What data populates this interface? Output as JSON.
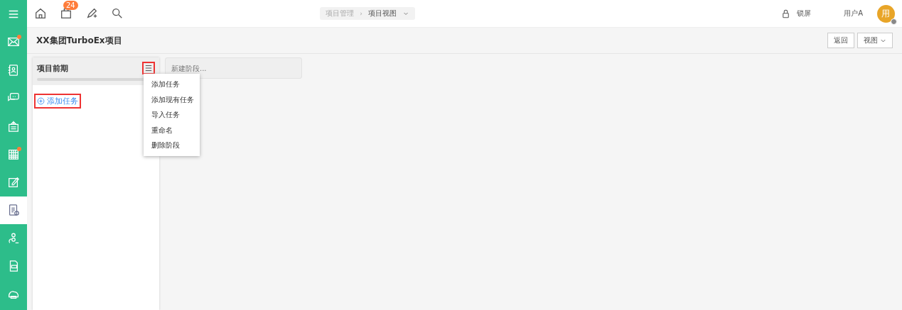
{
  "sidebar": {
    "items": [
      {
        "selected": false,
        "dot": false
      },
      {
        "selected": false,
        "dot": true
      },
      {
        "selected": false,
        "dot": false
      },
      {
        "selected": false,
        "dot": false
      },
      {
        "selected": false,
        "dot": false
      },
      {
        "selected": false,
        "dot": true
      },
      {
        "selected": false,
        "dot": false
      },
      {
        "selected": true,
        "dot": false
      },
      {
        "selected": false,
        "dot": false
      },
      {
        "selected": false,
        "dot": false
      },
      {
        "selected": false,
        "dot": false
      }
    ]
  },
  "toolbar": {
    "badge": "24"
  },
  "breadcrumb": [
    "项目管理",
    "›",
    "项目视图"
  ],
  "lock_label": "锁屏",
  "user": "用户A",
  "avatar": "用",
  "page_title": "XX集团TurboEx项目",
  "buttons": {
    "back": "返回",
    "view": "视图"
  },
  "stage": {
    "title": "项目前期",
    "progress": {
      "level": 0
    },
    "menu_highlighted": true,
    "add_task": "添加任务",
    "add_task_highlighted": true
  },
  "new_stage": {
    "placeholder": "新建阶段..."
  },
  "stage_menu": [
    "添加任务",
    "添加现有任务",
    "导入任务",
    "重命名",
    "删除阶段"
  ]
}
